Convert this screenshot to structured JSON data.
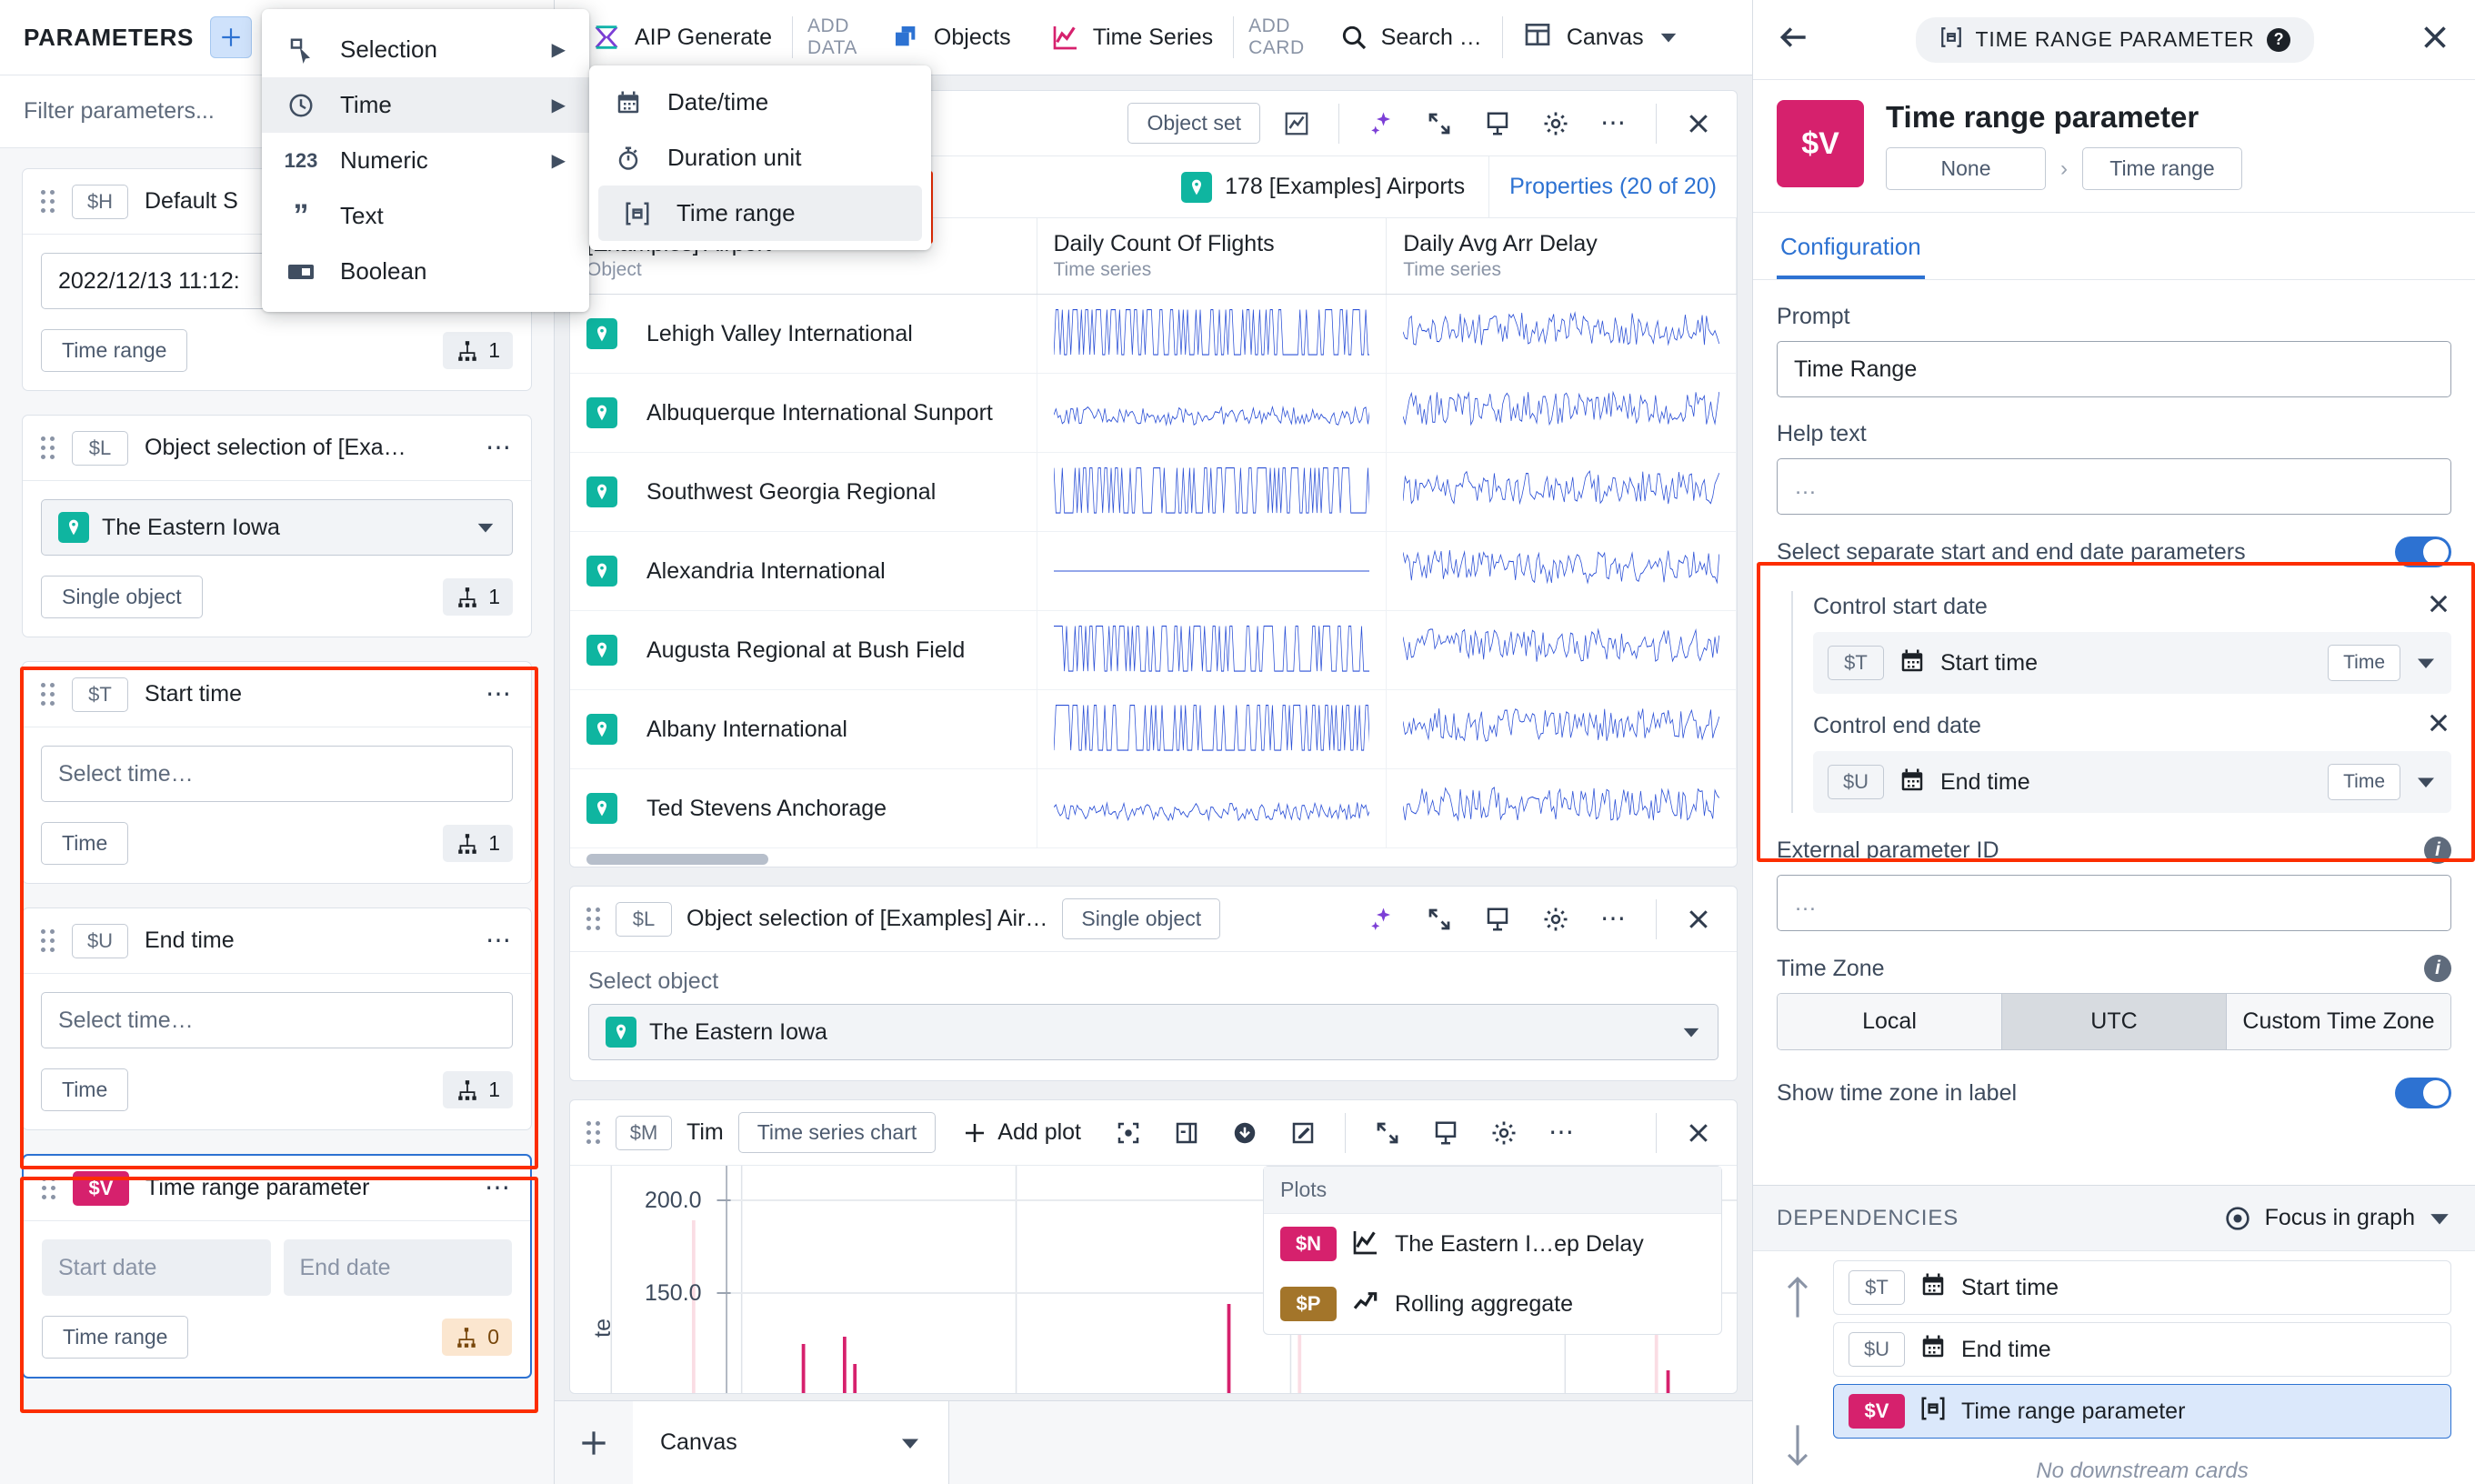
{
  "left_panel": {
    "title": "PARAMETERS",
    "add_button_icon": "plus-icon",
    "filter_placeholder": "Filter parameters...",
    "cards": [
      {
        "var": "$H",
        "name": "Default S",
        "value": "2022/12/13 11:12:",
        "type_pill": "Time range",
        "count": "1"
      },
      {
        "var": "$L",
        "name": "Object selection of [Exa…",
        "value": "The Eastern Iowa",
        "type_pill": "Single object",
        "count": "1"
      },
      {
        "var": "$T",
        "name": "Start time",
        "value": "Select time…",
        "type_pill": "Time",
        "count": "1"
      },
      {
        "var": "$U",
        "name": "End time",
        "value": "Select time…",
        "type_pill": "Time",
        "count": "1"
      },
      {
        "var": "$V",
        "name": "Time range parameter",
        "start_placeholder": "Start date",
        "end_placeholder": "End date",
        "type_pill": "Time range",
        "count": "0"
      }
    ]
  },
  "menu": {
    "items": [
      {
        "label": "Selection",
        "icon": "selection-cursor-icon",
        "has_sub": true
      },
      {
        "label": "Time",
        "icon": "clock-icon",
        "has_sub": true
      },
      {
        "label": "Numeric",
        "icon": "123-icon",
        "has_sub": true
      },
      {
        "label": "Text",
        "icon": "quote-icon",
        "has_sub": false
      },
      {
        "label": "Boolean",
        "icon": "toggle-icon",
        "has_sub": false
      }
    ],
    "submenu": [
      {
        "label": "Date/time",
        "icon": "calendar-icon"
      },
      {
        "label": "Duration unit",
        "icon": "stopwatch-icon"
      },
      {
        "label": "Time range",
        "icon": "time-range-icon"
      }
    ]
  },
  "toolbar": {
    "aip_generate": "AIP Generate",
    "add_data_line1": "ADD",
    "add_data_line2": "DATA",
    "objects": "Objects",
    "time_series": "Time Series",
    "add_card_line1": "ADD",
    "add_card_line2": "CARD",
    "search": "Search …",
    "canvas": "Canvas"
  },
  "object_card": {
    "title_hidden": "[Examples] Airport",
    "subtitle": "Object",
    "chip": "Object set",
    "object_count": "178 [Examples] Airports",
    "properties": "Properties (20 of 20)",
    "columns": [
      {
        "name": "[Examples] Airport",
        "sub": "Object"
      },
      {
        "name": "Daily Count Of Flights",
        "sub": "Time series"
      },
      {
        "name": "Daily Avg Arr Delay",
        "sub": "Time series"
      }
    ],
    "rows": [
      "Lehigh Valley International",
      "Albuquerque International Sunport",
      "Southwest Georgia Regional",
      "Alexandria International",
      "Augusta Regional at Bush Field",
      "Albany International",
      "Ted Stevens Anchorage"
    ]
  },
  "selection_card": {
    "var": "$L",
    "title": "Object selection of [Examples] Air…",
    "chip": "Single object",
    "label": "Select object",
    "value": "The Eastern Iowa"
  },
  "chart_card": {
    "var": "$M",
    "title": "Tim",
    "chip": "Time series chart",
    "add_plot": "Add plot",
    "plots_header": "Plots",
    "plots": [
      {
        "var": "$N",
        "name": "The Eastern I…ep Delay",
        "icon": "line-chart-icon"
      },
      {
        "var": "$P",
        "name": "Rolling aggregate",
        "icon": "trend-up-icon"
      }
    ]
  },
  "chart_data": {
    "type": "line",
    "title": "",
    "ylabel": "te",
    "yticks": [
      "200.0",
      "150.0"
    ],
    "ylim": [
      0,
      230
    ],
    "grid": true
  },
  "bottom_bar": {
    "add_icon": "plus-icon",
    "tab": "Canvas"
  },
  "right_panel": {
    "back_icon": "arrow-left-icon",
    "badge": "TIME RANGE PARAMETER",
    "close_icon": "close-icon",
    "hero_var": "$V",
    "hero_title": "Time range parameter",
    "breadcrumb": [
      "None",
      "Time range"
    ],
    "tab": "Configuration",
    "prompt_label": "Prompt",
    "prompt_value": "Time Range",
    "help_label": "Help text",
    "help_placeholder": "…",
    "separate_label": "Select separate start and end date parameters",
    "separate_on": true,
    "control_start_label": "Control start date",
    "control_start": {
      "var": "$T",
      "name": "Start time",
      "type": "Time"
    },
    "control_end_label": "Control end date",
    "control_end": {
      "var": "$U",
      "name": "End time",
      "type": "Time"
    },
    "external_label": "External parameter ID",
    "external_placeholder": "…",
    "timezone_label": "Time Zone",
    "timezone_options": [
      "Local",
      "UTC",
      "Custom Time Zone"
    ],
    "timezone_selected": "UTC",
    "show_tz_label": "Show time zone in label",
    "show_tz_on": true,
    "dependencies_title": "DEPENDENCIES",
    "focus_label": "Focus in graph",
    "deps": [
      {
        "var": "$T",
        "name": "Start time",
        "active": false
      },
      {
        "var": "$U",
        "name": "End time",
        "active": false
      },
      {
        "var": "$V",
        "name": "Time range parameter",
        "active": true
      }
    ],
    "no_downstream": "No downstream cards"
  },
  "colors": {
    "accent": "#2d72d2",
    "pink": "#d6216d",
    "teal": "#0fb5a0",
    "annotation": "#fc2d00"
  }
}
